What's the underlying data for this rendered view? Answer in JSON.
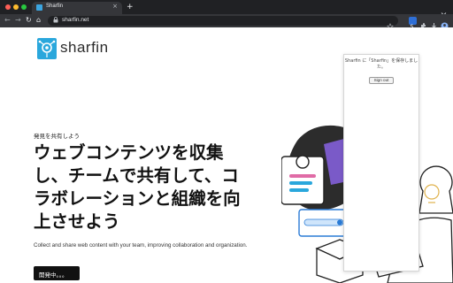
{
  "browser": {
    "tab_title": "Sharfin",
    "tab_close": "×",
    "new_tab": "+",
    "url": "sharfin.net",
    "nav": {
      "back": "←",
      "forward": "→",
      "reload": "↻",
      "home": "⌂"
    },
    "lock": "🔒",
    "menu": "⋮"
  },
  "logo": {
    "text": "sharfin"
  },
  "hero": {
    "eyebrow": "発見を共有しよう",
    "headline": "ウェブコンテンツを収集し、チームで共有して、コラボレーションと組織を向上させよう",
    "description": "Collect and share web content with your team, improving collaboration and organization.",
    "cta_label": "開発中。。。"
  },
  "popup": {
    "message": "Sharfin に「Sharfin」を保存しました。",
    "signout_label": "Sign out"
  },
  "colors": {
    "brand": "#2aa7dc",
    "chrome_dark": "#202124",
    "chrome_toolbar": "#35363a",
    "cta_bg": "#111111"
  }
}
